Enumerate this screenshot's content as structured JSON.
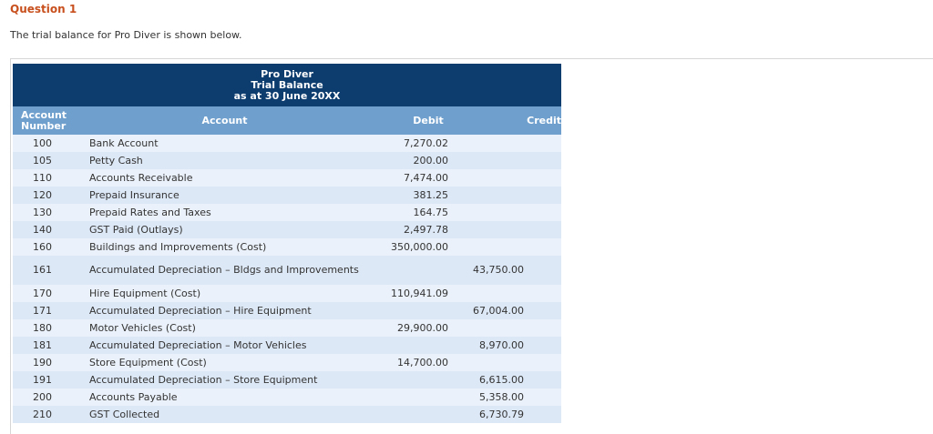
{
  "question": {
    "title": "Question 1",
    "intro": "The trial balance for Pro Diver is shown below."
  },
  "header": {
    "company": "Pro Diver",
    "report": "Trial Balance",
    "date": "as at 30 June 20XX"
  },
  "columns": {
    "number": "Account Number",
    "account": "Account",
    "debit": "Debit",
    "credit": "Credit"
  },
  "rows": [
    {
      "num": "100",
      "account": "Bank Account",
      "debit": "7,270.02",
      "credit": ""
    },
    {
      "num": "105",
      "account": "Petty Cash",
      "debit": "200.00",
      "credit": ""
    },
    {
      "num": "110",
      "account": "Accounts Receivable",
      "debit": "7,474.00",
      "credit": ""
    },
    {
      "num": "120",
      "account": "Prepaid Insurance",
      "debit": "381.25",
      "credit": ""
    },
    {
      "num": "130",
      "account": "Prepaid Rates and Taxes",
      "debit": "164.75",
      "credit": ""
    },
    {
      "num": "140",
      "account": "GST Paid (Outlays)",
      "debit": "2,497.78",
      "credit": ""
    },
    {
      "num": "160",
      "account": "Buildings and Improvements (Cost)",
      "debit": "350,000.00",
      "credit": ""
    },
    {
      "num": "161",
      "account": "Accumulated Depreciation – Bldgs and Improvements",
      "debit": "",
      "credit": "43,750.00"
    },
    {
      "num": "170",
      "account": "Hire Equipment (Cost)",
      "debit": "110,941.09",
      "credit": ""
    },
    {
      "num": "171",
      "account": "Accumulated Depreciation – Hire Equipment",
      "debit": "",
      "credit": "67,004.00"
    },
    {
      "num": "180",
      "account": "Motor Vehicles (Cost)",
      "debit": "29,900.00",
      "credit": ""
    },
    {
      "num": "181",
      "account": "Accumulated Depreciation – Motor Vehicles",
      "debit": "",
      "credit": "8,970.00"
    },
    {
      "num": "190",
      "account": "Store Equipment (Cost)",
      "debit": "14,700.00",
      "credit": ""
    },
    {
      "num": "191",
      "account": "Accumulated Depreciation – Store Equipment",
      "debit": "",
      "credit": "6,615.00"
    },
    {
      "num": "200",
      "account": "Accounts Payable",
      "debit": "",
      "credit": "5,358.00"
    },
    {
      "num": "210",
      "account": "GST Collected",
      "debit": "",
      "credit": "6,730.79"
    }
  ]
}
